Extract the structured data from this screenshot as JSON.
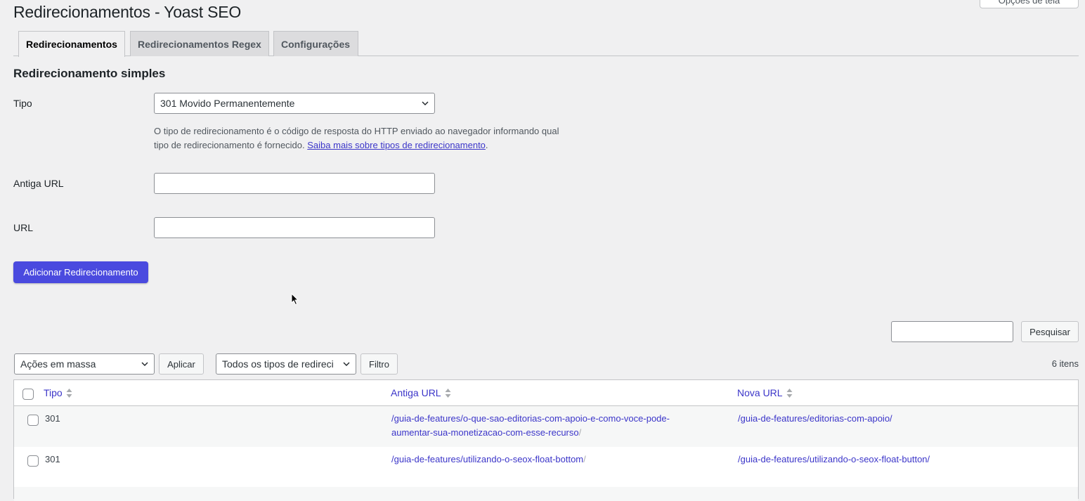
{
  "screen_options_label": "Opções de tela",
  "page_title": "Redirecionamentos - Yoast SEO",
  "tabs": [
    {
      "label": "Redirecionamentos",
      "active": true
    },
    {
      "label": "Redirecionamentos Regex",
      "active": false
    },
    {
      "label": "Configurações",
      "active": false
    }
  ],
  "form": {
    "section_title": "Redirecionamento simples",
    "type_label": "Tipo",
    "type_value": "301 Movido Permanentemente",
    "description_text": "O tipo de redirecionamento é o código de resposta do HTTP enviado ao navegador informando qual tipo de redirecionamento é fornecido.",
    "description_link": "Saiba mais sobre tipos de redirecionamento",
    "description_end": ".",
    "old_url_label": "Antiga URL",
    "old_url_value": "",
    "url_label": "URL",
    "url_value": "",
    "submit_label": "Adicionar Redirecionamento"
  },
  "toolbar": {
    "search_value": "",
    "search_button": "Pesquisar",
    "bulk_actions": "Ações em massa",
    "apply_button": "Aplicar",
    "type_filter": "Todos os tipos de redireci",
    "filter_button": "Filtro",
    "items_count": "6 itens"
  },
  "table": {
    "columns": [
      "Tipo",
      "Antiga URL",
      "Nova URL"
    ],
    "rows": [
      {
        "type": "301",
        "old_url_line1": "/guia-de-features/o-que-sao-editorias-com-apoio-e-como-voce-pode-",
        "old_url_line2": "aumentar-sua-monetizacao-com-esse-recurso",
        "old_url_suffix": "/",
        "new_url": "/guia-de-features/editorias-com-apoio/"
      },
      {
        "type": "301",
        "old_url_line1": "/guia-de-features/utilizando-o-seox-float-bottom",
        "old_url_line2": "",
        "old_url_suffix": "/",
        "new_url": "/guia-de-features/utilizando-o-seox-float-button/"
      }
    ]
  },
  "colors": {
    "accent": "#4a4adf",
    "link": "#3b35c9",
    "background": "#f0f0f1"
  }
}
